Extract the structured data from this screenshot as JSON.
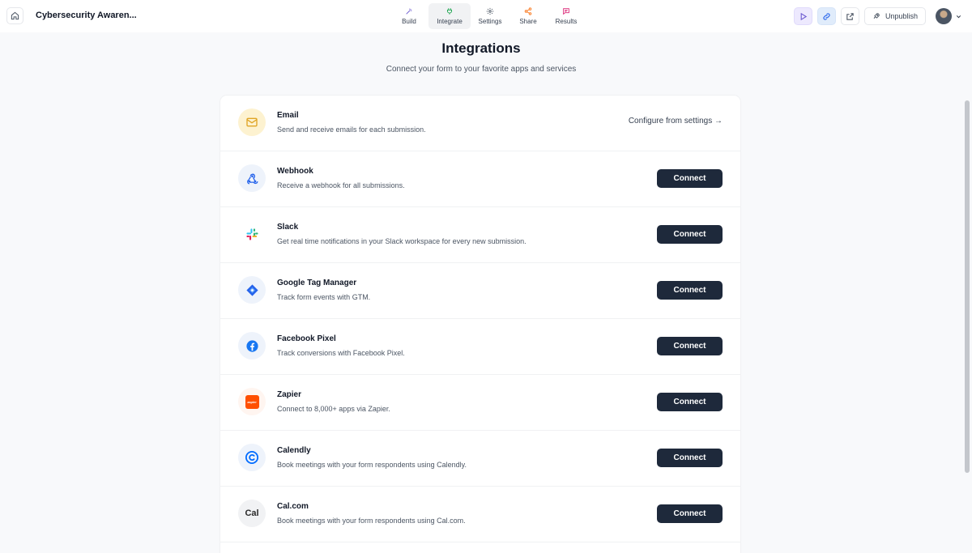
{
  "topbar": {
    "form_title": "Cybersecurity Awaren...",
    "tabs": [
      {
        "label": "Build",
        "icon": "wand-icon",
        "color": "#6d5bd0"
      },
      {
        "label": "Integrate",
        "icon": "plug-icon",
        "color": "#16a34a"
      },
      {
        "label": "Settings",
        "icon": "gear-icon",
        "color": "#4b5563"
      },
      {
        "label": "Share",
        "icon": "share-icon",
        "color": "#f97316"
      },
      {
        "label": "Results",
        "icon": "chat-icon",
        "color": "#db2777"
      }
    ],
    "unpublish_label": "Unpublish"
  },
  "header": {
    "title": "Integrations",
    "subtitle": "Connect your form to your favorite apps and services"
  },
  "integrations": [
    {
      "name": "Email",
      "description": "Send and receive emails for each submission.",
      "icon": "mail-icon",
      "action": "Configure from settings →"
    },
    {
      "name": "Webhook",
      "description": "Receive a webhook for all submissions.",
      "icon": "webhook-icon",
      "action": "Connect"
    },
    {
      "name": "Slack",
      "description": "Get real time notifications in your Slack workspace for every new submission.",
      "icon": "slack-icon",
      "action": "Connect"
    },
    {
      "name": "Google Tag Manager",
      "description": "Track form events with GTM.",
      "icon": "gtm-icon",
      "action": "Connect"
    },
    {
      "name": "Facebook Pixel",
      "description": "Track conversions with Facebook Pixel.",
      "icon": "facebook-icon",
      "action": "Connect"
    },
    {
      "name": "Zapier",
      "description": "Connect to 8,000+ apps via Zapier.",
      "icon": "zapier-icon",
      "zapier_text": "zapier",
      "action": "Connect"
    },
    {
      "name": "Calendly",
      "description": "Book meetings with your form respondents using Calendly.",
      "icon": "calendly-icon",
      "action": "Connect"
    },
    {
      "name": "Cal.com",
      "description": "Book meetings with your form respondents using Cal.com.",
      "icon": "calcom-icon",
      "calcom_text": "Cal",
      "action": "Connect"
    }
  ],
  "colors": {
    "button_bg": "#1e293b",
    "email_icon_bg": "#fdf2d0",
    "email_icon": "#e0a526",
    "webhook_icon": "#2563eb",
    "gtm_blue": "#2563eb",
    "facebook_blue": "#1877f2",
    "zapier_orange": "#ff4f00",
    "calendly_blue": "#006bff"
  }
}
